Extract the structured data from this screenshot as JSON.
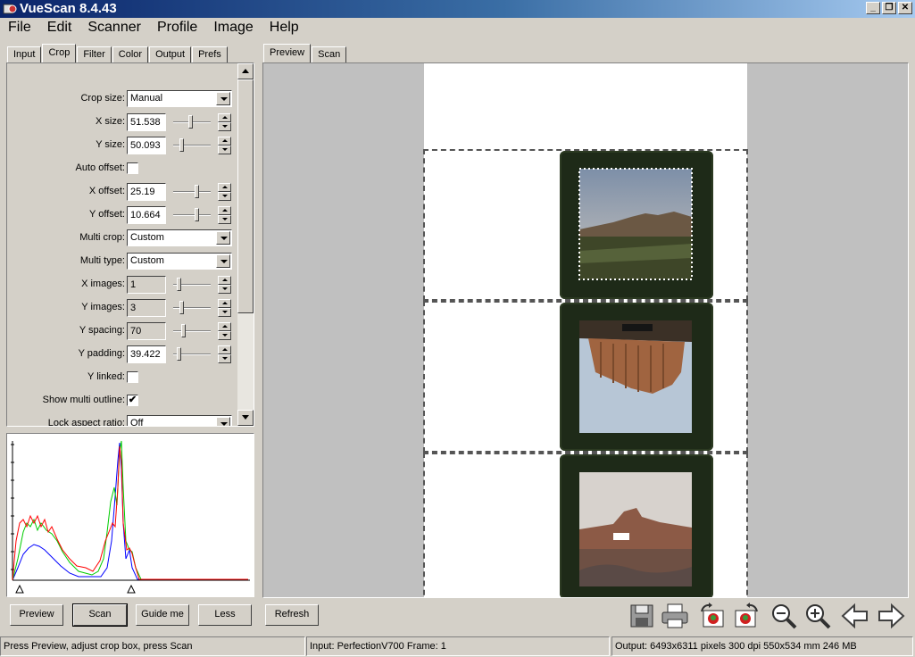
{
  "window": {
    "title": "VueScan 8.4.43",
    "minimize": "_",
    "restore": "❐",
    "close": "✕"
  },
  "menu": [
    "File",
    "Edit",
    "Scanner",
    "Profile",
    "Image",
    "Help"
  ],
  "settings_tabs": [
    "Input",
    "Crop",
    "Filter",
    "Color",
    "Output",
    "Prefs"
  ],
  "active_settings_tab": "Crop",
  "crop": {
    "crop_size": {
      "label": "Crop size:",
      "value": "Manual"
    },
    "x_size": {
      "label": "X size:",
      "value": "51.538",
      "slider": 0.45
    },
    "y_size": {
      "label": "Y size:",
      "value": "50.093",
      "slider": 0.2
    },
    "auto_offset": {
      "label": "Auto offset:",
      "checked": false
    },
    "x_offset": {
      "label": "X offset:",
      "value": "25.19",
      "slider": 0.65
    },
    "y_offset": {
      "label": "Y offset:",
      "value": "10.664",
      "slider": 0.65
    },
    "multi_crop": {
      "label": "Multi crop:",
      "value": "Custom"
    },
    "multi_type": {
      "label": "Multi type:",
      "value": "Custom"
    },
    "x_images": {
      "label": "X images:",
      "value": "1",
      "slider": 0.1
    },
    "y_images": {
      "label": "Y images:",
      "value": "3",
      "slider": 0.18
    },
    "y_spacing": {
      "label": "Y spacing:",
      "value": "70",
      "slider": 0.25
    },
    "y_padding": {
      "label": "Y padding:",
      "value": "39.422",
      "slider": 0.1
    },
    "y_linked": {
      "label": "Y linked:",
      "checked": false
    },
    "show_multi_outline": {
      "label": "Show multi outline:",
      "checked": true,
      "mark": "✔"
    },
    "lock_aspect_ratio": {
      "label": "Lock aspect ratio:",
      "value": "Off"
    }
  },
  "preview_tabs": [
    "Preview",
    "Scan"
  ],
  "active_preview_tab": "Preview",
  "buttons": {
    "preview": "Preview",
    "scan": "Scan",
    "guide_me": "Guide me",
    "less": "Less",
    "refresh": "Refresh"
  },
  "toolbar_icons": [
    "save-icon",
    "print-icon",
    "rotate-left-icon",
    "rotate-right-icon",
    "zoom-out-icon",
    "zoom-in-icon",
    "back-arrow-icon",
    "forward-arrow-icon"
  ],
  "status": {
    "left": "Press Preview, adjust crop box, press Scan",
    "middle": "Input: PerfectionV700 Frame: 1",
    "right": "Output: 6493x6311 pixels 300 dpi 550x534 mm 246 MB"
  },
  "colors": {
    "titlebar": "#0a246a",
    "face": "#d4d0c8",
    "histogram_red": "#ff0000",
    "histogram_green": "#00cc00",
    "histogram_blue": "#0000ff"
  }
}
